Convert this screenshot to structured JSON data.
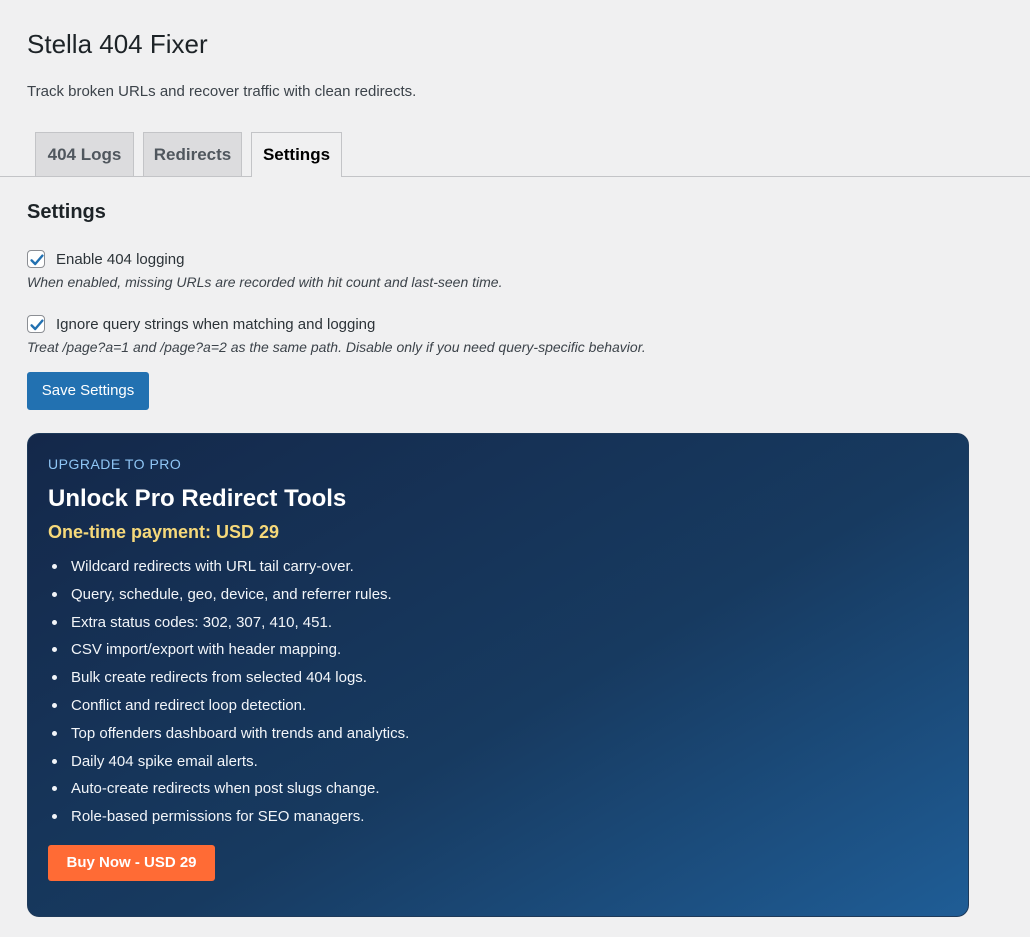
{
  "header": {
    "title": "Stella 404 Fixer",
    "subtitle": "Track broken URLs and recover traffic with clean redirects."
  },
  "tabs": [
    {
      "label": "404 Logs",
      "active": false
    },
    {
      "label": "Redirects",
      "active": false
    },
    {
      "label": "Settings",
      "active": true
    }
  ],
  "settings": {
    "heading": "Settings",
    "options": [
      {
        "label": "Enable 404 logging",
        "checked": true,
        "description": "When enabled, missing URLs are recorded with hit count and last-seen time."
      },
      {
        "label": "Ignore query strings when matching and logging",
        "checked": true,
        "description": "Treat /page?a=1 and /page?a=2 as the same path. Disable only if you need query-specific behavior."
      }
    ],
    "save_label": "Save Settings"
  },
  "promo": {
    "eyebrow": "UPGRADE TO PRO",
    "title": "Unlock Pro Redirect Tools",
    "price": "One-time payment: USD 29",
    "features": [
      "Wildcard redirects with URL tail carry-over.",
      "Query, schedule, geo, device, and referrer rules.",
      "Extra status codes: 302, 307, 410, 451.",
      "CSV import/export with header mapping.",
      "Bulk create redirects from selected 404 logs.",
      "Conflict and redirect loop detection.",
      "Top offenders dashboard with trends and analytics.",
      "Daily 404 spike email alerts.",
      "Auto-create redirects when post slugs change.",
      "Role-based permissions for SEO managers."
    ],
    "buy_label": "Buy Now - USD 29"
  },
  "colors": {
    "accent": "#2271b1",
    "checkmark": "#2271b1",
    "promo_price": "#f6d97a",
    "buy_button": "#ff6b35"
  },
  "icons": {
    "checkbox_checked": "checkmark-icon"
  }
}
